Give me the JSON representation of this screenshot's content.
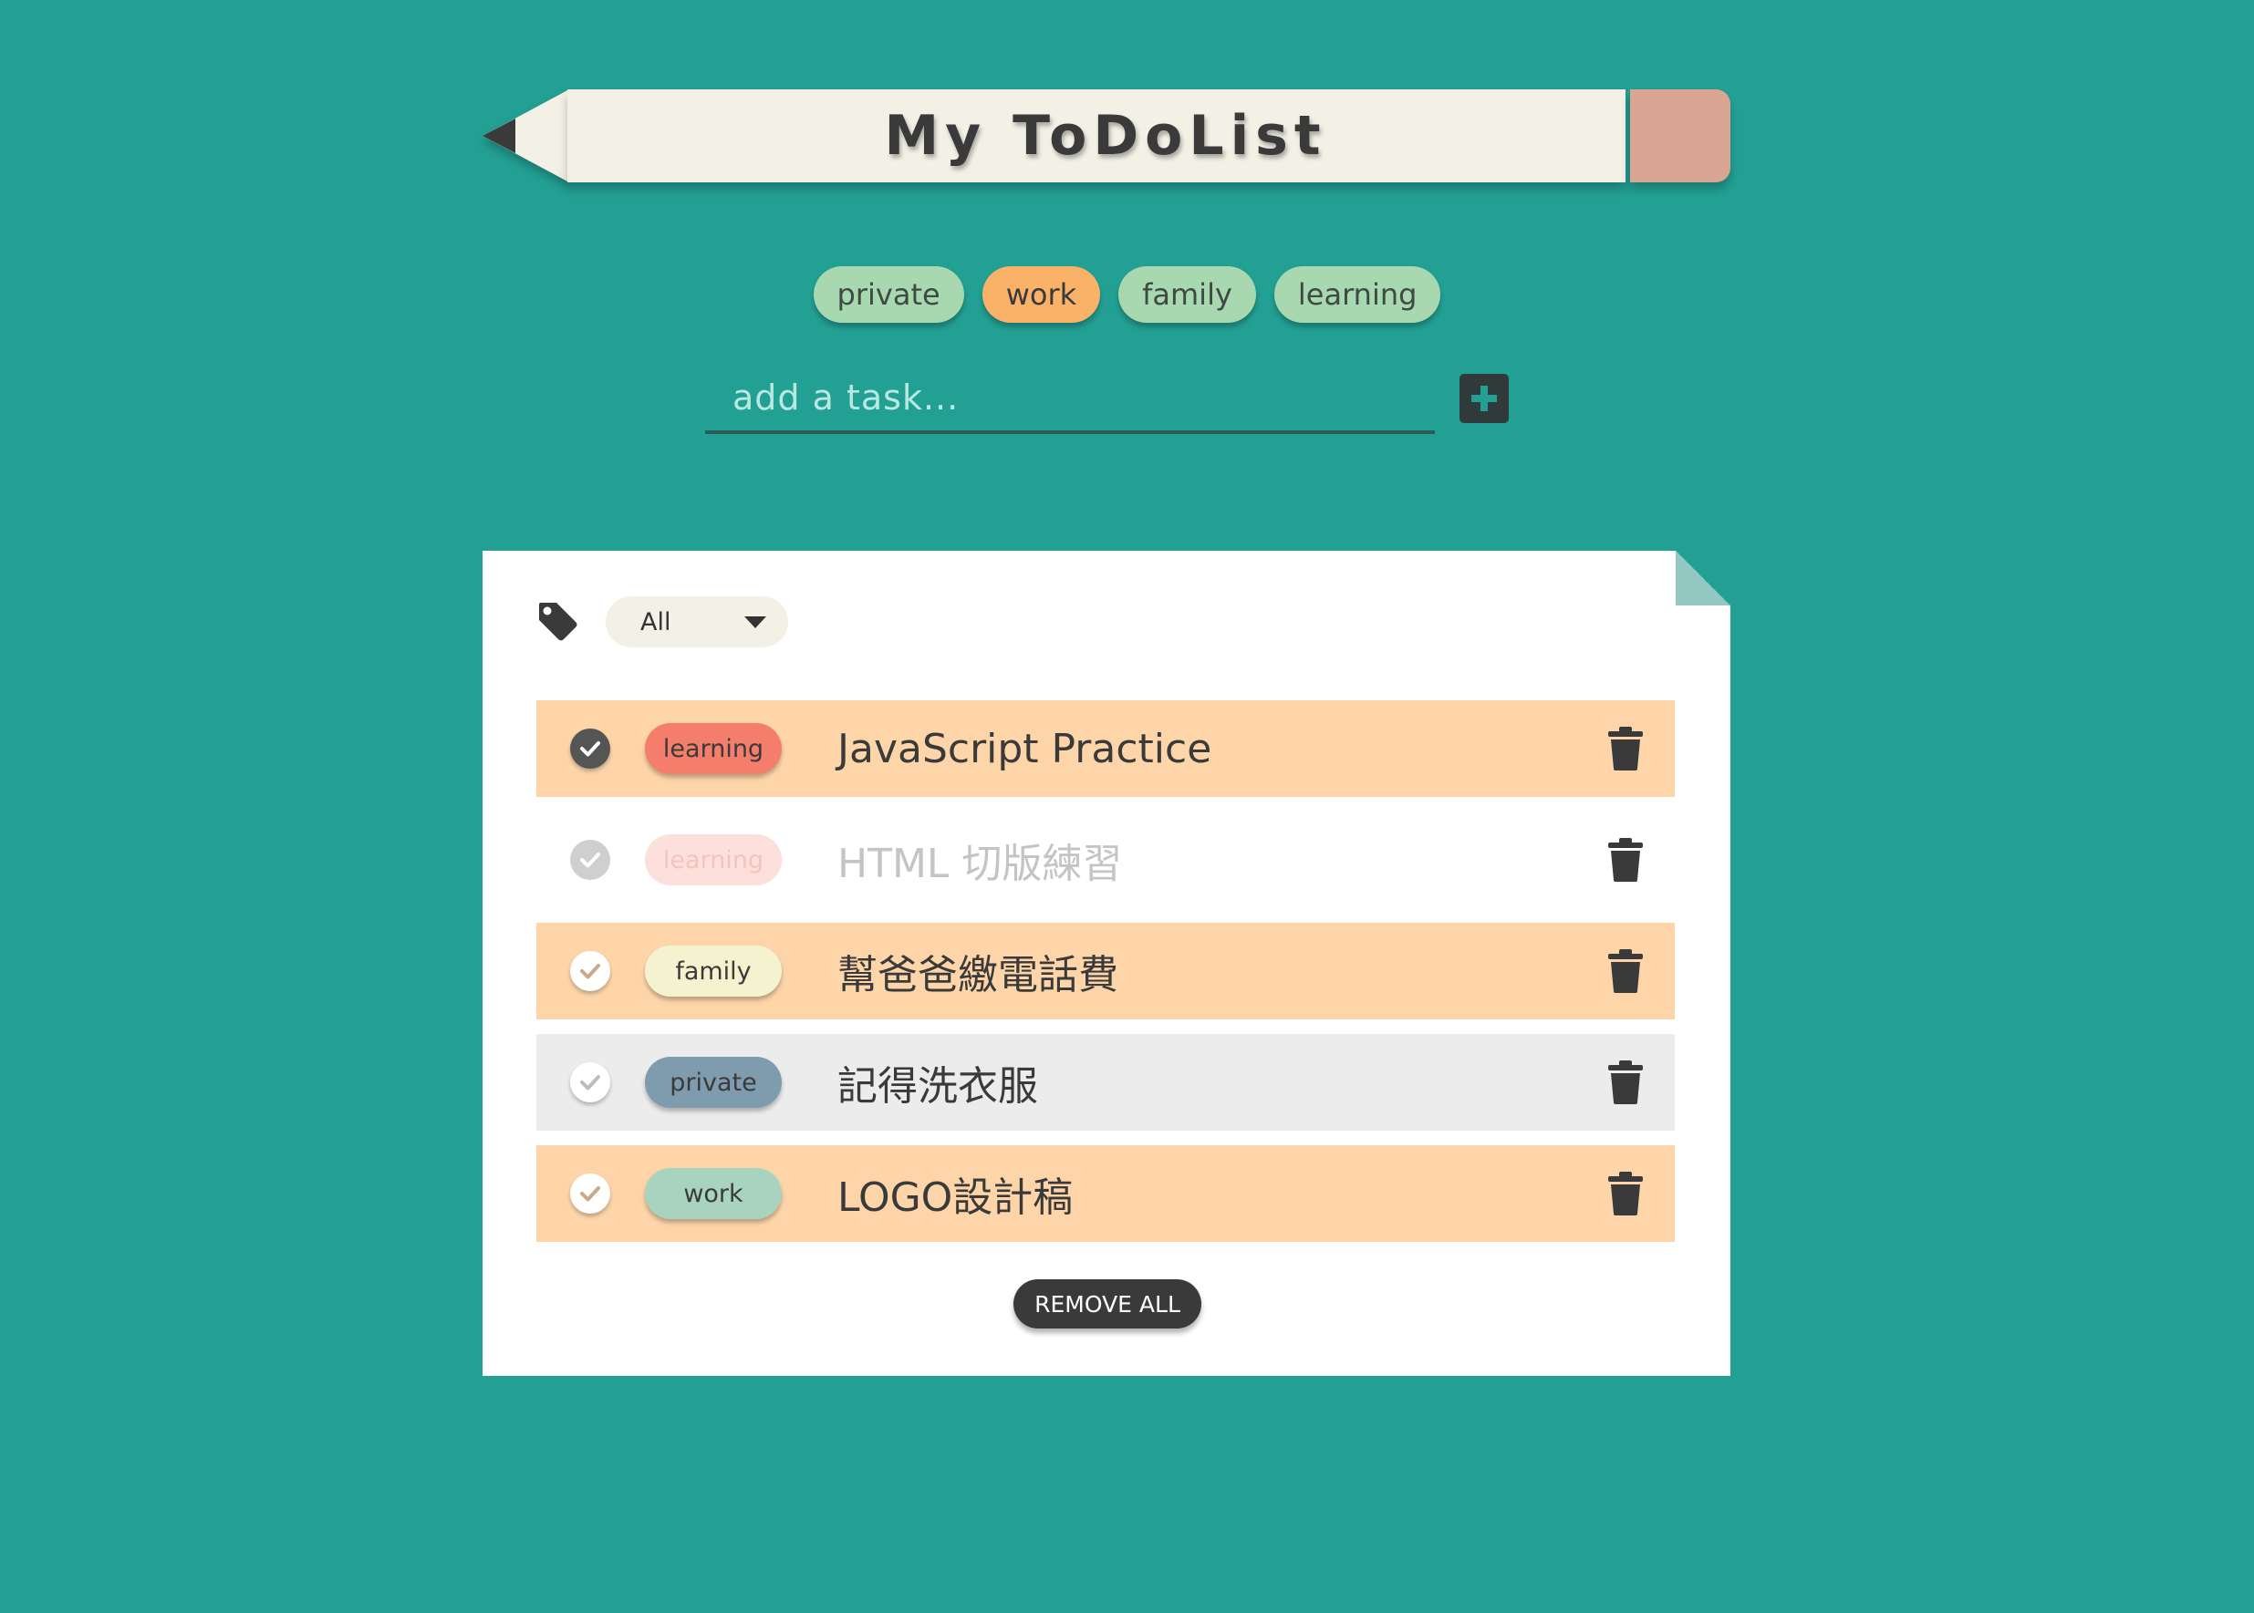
{
  "app": {
    "title": "My ToDoList"
  },
  "category_tags": [
    {
      "label": "private",
      "active": false
    },
    {
      "label": "work",
      "active": true
    },
    {
      "label": "family",
      "active": false
    },
    {
      "label": "learning",
      "active": false
    }
  ],
  "add_task": {
    "placeholder": "add a task...",
    "value": "",
    "button_icon": "plus-icon"
  },
  "filter": {
    "icon": "tag-icon",
    "selected": "All"
  },
  "tasks": [
    {
      "tag": "learning",
      "text": "JavaScript Practice",
      "done": true,
      "row_color": "#fdd5a9",
      "tag_color": "#f47e6b",
      "tag_text_color": "#3a3a3a"
    },
    {
      "tag": "learning",
      "text": "HTML 切版練習",
      "done": true,
      "completed_style": true,
      "row_color": "#ffffff",
      "tag_color": "#fde0dc",
      "tag_text_color": "#f3c4bd"
    },
    {
      "tag": "family",
      "text": "幫爸爸繳電話費",
      "done": false,
      "row_color": "#fdd5a9",
      "tag_color": "#f5f3cf",
      "tag_text_color": "#3a3a3a"
    },
    {
      "tag": "private",
      "text": "記得洗衣服",
      "done": false,
      "row_color": "#ececec",
      "tag_color": "#7f9caf",
      "tag_text_color": "#3a3a3a"
    },
    {
      "tag": "work",
      "text": "LOGO設計稿",
      "done": false,
      "row_color": "#fdd5a9",
      "tag_color": "#a8d4bf",
      "tag_text_color": "#3a3a3a"
    }
  ],
  "actions": {
    "remove_all_label": "REMOVE ALL"
  },
  "colors": {
    "background": "#23a094",
    "pencil_body": "#f3f1e6",
    "eraser": "#dba594",
    "tag_default": "#a8d8b0",
    "tag_active": "#f9b268",
    "dark": "#3a3a3a"
  }
}
